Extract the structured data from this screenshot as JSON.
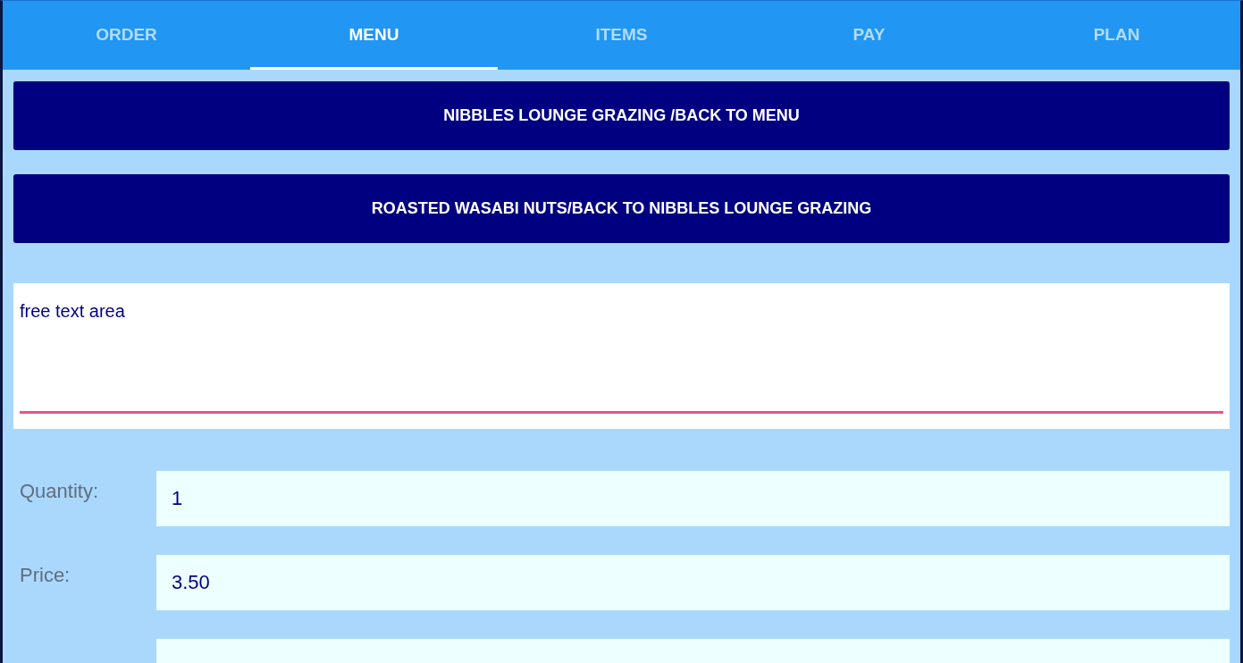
{
  "tabs": [
    {
      "label": "ORDER",
      "selected": false
    },
    {
      "label": "MENU",
      "selected": true
    },
    {
      "label": "ITEMS",
      "selected": false
    },
    {
      "label": "PAY",
      "selected": false
    },
    {
      "label": "PLAN",
      "selected": false
    }
  ],
  "nav_buttons": [
    "NIBBLES LOUNGE GRAZING /BACK TO MENU",
    "ROASTED WASABI NUTS/BACK TO NIBBLES LOUNGE GRAZING"
  ],
  "notes": {
    "value": "free text area",
    "focused": true
  },
  "fields": [
    {
      "label": "Quantity:",
      "value": "1"
    },
    {
      "label": "Price:",
      "value": "3.50"
    }
  ],
  "more_fields_below": true
}
